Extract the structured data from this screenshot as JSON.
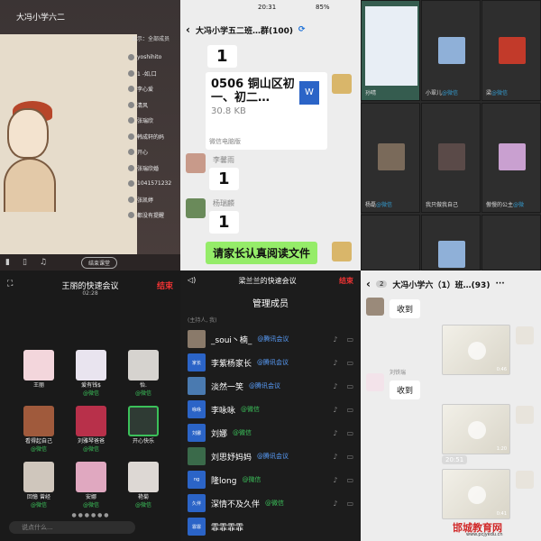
{
  "p1": {
    "title": "大冯小学六二",
    "show_label": "显示：全部成员",
    "members": [
      "yoshihito",
      "1 -如,口",
      "李心爱",
      "清风",
      "张瑞欣",
      "韩成轩的妈",
      "开心",
      "张瑞欣婚",
      "1041571232",
      "张凯婷",
      "都没有提醒"
    ],
    "pill": "结束课堂"
  },
  "p2": {
    "time": "20:31",
    "battery": "85%",
    "title": "大冯小学五二班…群(100)",
    "msg_one": "1",
    "file_name": "0506 铜山区初一、初二…",
    "file_size": "30.8 KB",
    "file_source": "微信电脑版",
    "sender1": "李馨雨",
    "msg1": "1",
    "sender2": "杨瑞麟",
    "msg2": "1",
    "final_msg": "请家长认真阅读文件"
  },
  "p3": {
    "tiles": [
      {
        "name": "孙晴",
        "src": ""
      },
      {
        "name": "小翠儿",
        "src": "@微信"
      },
      {
        "name": "梁",
        "src": "@微信"
      },
      {
        "name": "杨磊",
        "src": "@微信"
      },
      {
        "name": "我只做我自己",
        "src": ""
      },
      {
        "name": "傲慢的公主",
        "src": "@微"
      }
    ]
  },
  "p4": {
    "title": "王丽的快速会议",
    "time": "02:28",
    "end": "结束",
    "participants": [
      {
        "name": "王丽",
        "src": ""
      },
      {
        "name": "爱有钱$",
        "src": "@微信"
      },
      {
        "name": "怡.",
        "src": "@微信"
      },
      {
        "name": "看得起自己",
        "src": "@微信"
      },
      {
        "name": "刘雅琴爸爸",
        "src": "@微信"
      },
      {
        "name": "开心快乐",
        "src": ""
      },
      {
        "name": "回憶 曾经",
        "src": "@微信"
      },
      {
        "name": "安娜",
        "src": "@微信"
      },
      {
        "name": "艳菊",
        "src": "@微信"
      }
    ],
    "input_placeholder": "说点什么..."
  },
  "p5": {
    "title": "梁兰兰的快速会议",
    "end": "结束",
    "manage": "管理成员",
    "host_label": "(主持人, 我)",
    "members": [
      {
        "name": "_soui丶楠_",
        "src": "@腾讯会议",
        "av": "",
        "wx": false
      },
      {
        "name": "李紫杨家长",
        "src": "@腾讯会议",
        "av": "家长",
        "wx": false
      },
      {
        "name": "淡然一笑",
        "src": "@腾讯会议",
        "av": "",
        "wx": false
      },
      {
        "name": "李咏咏",
        "src": "@微信",
        "av": "咏咏",
        "wx": true
      },
      {
        "name": "刘娜",
        "src": "@微信",
        "av": "刘娜",
        "wx": true
      },
      {
        "name": "刘思妤妈妈",
        "src": "@腾讯会议",
        "av": "",
        "wx": false
      },
      {
        "name": "隆long",
        "src": "@微信",
        "av": "ng",
        "wx": true
      },
      {
        "name": "深情不及久伴",
        "src": "@微信",
        "av": "久伴",
        "wx": true
      },
      {
        "name": "霏霏霏霏",
        "src": "",
        "av": "霏霏",
        "wx": false
      }
    ]
  },
  "p6": {
    "badge": "2",
    "title": "大冯小学六（1）班…(93)",
    "received1": "收到",
    "sender": "刘铁瑞",
    "received2": "收到",
    "time_pill": "20:51",
    "video_durations": [
      "0:46",
      "1:20",
      "0:41"
    ]
  },
  "watermark": {
    "text": "邯城教育网",
    "url": "www.pcjyedu.cn"
  }
}
